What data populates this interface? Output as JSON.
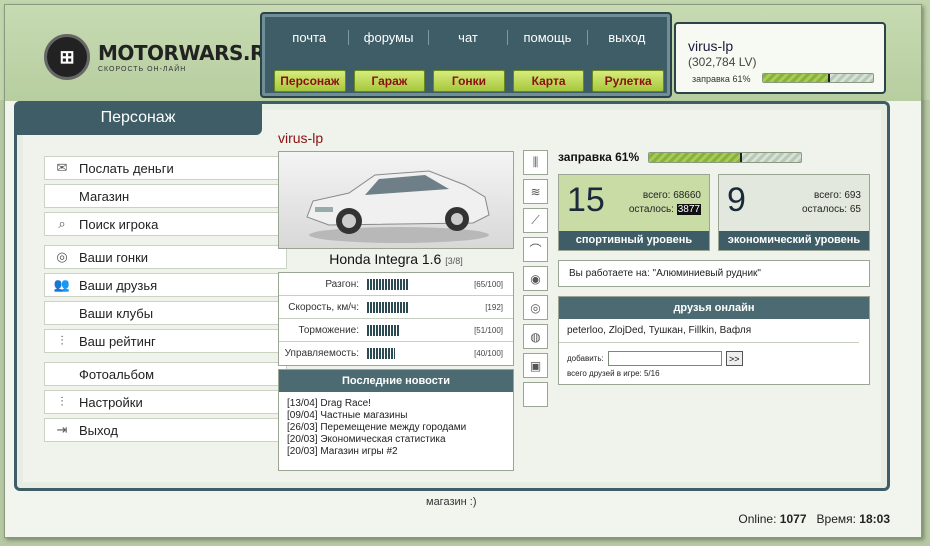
{
  "logo": {
    "title": "MOTORWARS.RU",
    "subtitle": "СКОРОСТЬ ОН-ЛАЙН"
  },
  "topnav": {
    "links": [
      "почта",
      "форумы",
      "чат",
      "помощь",
      "выход"
    ],
    "buttons": [
      "Персонаж",
      "Гараж",
      "Гонки",
      "Карта",
      "Рулетка"
    ]
  },
  "user": {
    "name": "virus-lp",
    "money": "(302,784 LV)",
    "fuel_label": "заправка 61%",
    "fuel_pct": 61
  },
  "section_title": "Персонаж",
  "sidebar": {
    "items": [
      {
        "label": "Послать деньги",
        "icon": "money-icon"
      },
      {
        "label": "Магазин",
        "icon": ""
      },
      {
        "label": "Поиск игрока",
        "icon": "search-icon"
      },
      {
        "label": "Ваши гонки",
        "icon": "steering-wheel-icon"
      },
      {
        "label": "Ваши друзья",
        "icon": "friends-icon"
      },
      {
        "label": "Ваши клубы",
        "icon": ""
      },
      {
        "label": "Ваш рейтинг",
        "icon": "sliders-icon"
      },
      {
        "label": "Фотоальбом",
        "icon": ""
      },
      {
        "label": "Настройки",
        "icon": "sliders-icon"
      },
      {
        "label": "Выход",
        "icon": "exit-door-icon"
      }
    ]
  },
  "car": {
    "owner": "virus-lp",
    "name": "Honda Integra 1.6",
    "slot": "[3/8]",
    "stats": [
      {
        "label": "Разгон:",
        "value": "[65/100]"
      },
      {
        "label": "Скорость, км/ч:",
        "value": "[192]"
      },
      {
        "label": "Торможение:",
        "value": "[51/100]"
      },
      {
        "label": "Управляемость:",
        "value": "[40/100]"
      }
    ]
  },
  "news": {
    "title": "Последние новости",
    "items": [
      "[13/04] Drag Race!",
      "[09/04] Частные магазины",
      "[26/03] Перемещение между городами",
      "[20/03] Экономическая статистика",
      "[20/03] Магазин игры #2"
    ]
  },
  "parts": [
    "shock-absorber-icon",
    "spring-icon",
    "spark-plug-icon",
    "belt-icon",
    "brake-disc-icon",
    "wheel-icon",
    "turbo-icon",
    "gearbox-icon",
    "empty-slot"
  ],
  "fuel": {
    "label": "заправка 61%",
    "pct": 61
  },
  "sport_level": {
    "level": "15",
    "total_label": "всего:",
    "total": "68660",
    "left_label": "осталось:",
    "left": "3877",
    "caption": "спортивный уровень"
  },
  "econ_level": {
    "level": "9",
    "total_label": "всего:",
    "total": "693",
    "left_label": "осталось:",
    "left": "65",
    "caption": "экономический уровень"
  },
  "work": "Вы работаете на: \"Алюминиевый рудник\"",
  "friends": {
    "title": "друзья онлайн",
    "list": "peterloo, ZlojDed, Тушкан, Fillkin, Вафля",
    "add_label": "добавить:",
    "add_button": ">>",
    "total": "всего друзей в игре: 5/16"
  },
  "footer": {
    "status": "магазин :)",
    "online_label": "Online:",
    "online": "1077",
    "time_label": "Время:",
    "time": "18:03"
  }
}
